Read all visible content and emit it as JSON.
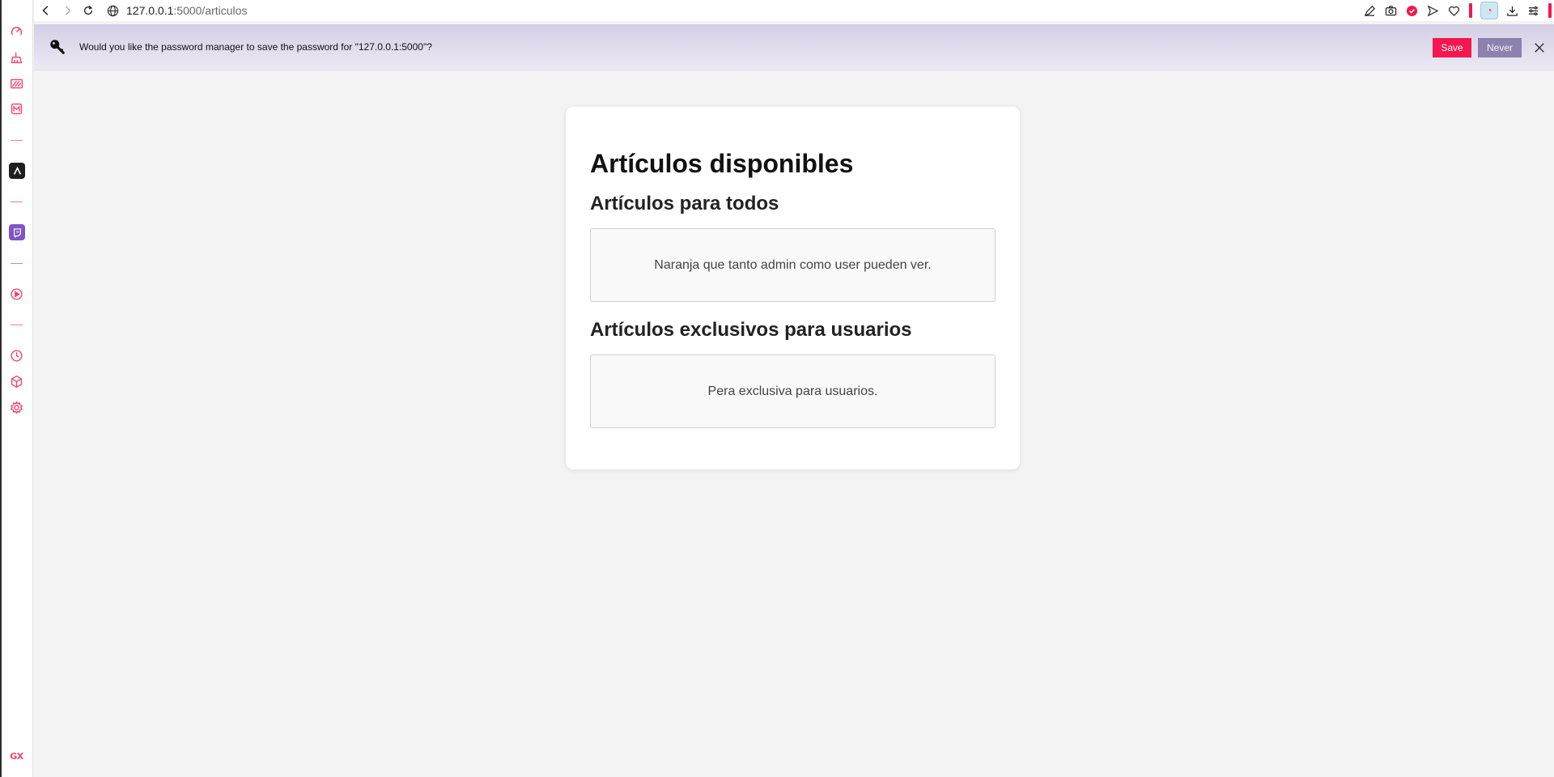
{
  "browser": {
    "url_host": "127.0.0.1",
    "url_path": ":5000/articulos",
    "sidebar_brand": "GX",
    "icons": {
      "back": "chevron-left-icon",
      "forward": "chevron-right-icon",
      "reload": "reload-icon",
      "site_info": "globe-icon"
    }
  },
  "infobar": {
    "message": "Would you like the password manager to save the password for \"127.0.0.1:5000\"?",
    "save_label": "Save",
    "never_label": "Never",
    "accent_color": "#f5174f"
  },
  "page": {
    "title": "Artículos disponibles",
    "sections": [
      {
        "heading": "Artículos para todos",
        "items": [
          "Naranja que tanto admin como user pueden ver."
        ]
      },
      {
        "heading": "Artículos exclusivos para usuarios",
        "items": [
          "Pera exclusiva para usuarios."
        ]
      }
    ]
  }
}
